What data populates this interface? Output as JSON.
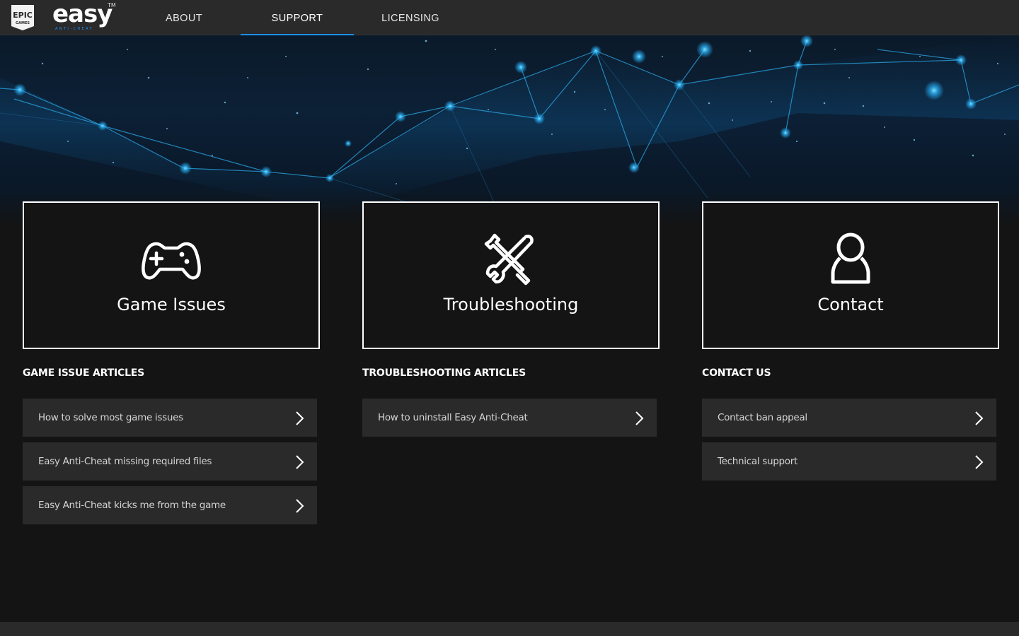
{
  "brand": {
    "epic_top": "EPIC",
    "epic_bottom": "GAMES",
    "product": "easy",
    "tm": "TM",
    "product_sub": "ANTI-CHEAT"
  },
  "nav": {
    "items": [
      {
        "label": "ABOUT",
        "active": false
      },
      {
        "label": "SUPPORT",
        "active": true
      },
      {
        "label": "LICENSING",
        "active": false
      }
    ],
    "accent": "#1b8fe8"
  },
  "cards": [
    {
      "title": "Game Issues",
      "icon": "gamepad-icon"
    },
    {
      "title": "Troubleshooting",
      "icon": "tools-icon"
    },
    {
      "title": "Contact",
      "icon": "user-icon"
    }
  ],
  "sections": [
    {
      "heading": "GAME ISSUE ARTICLES",
      "articles": [
        "How to solve most game issues",
        "Easy Anti-Cheat missing required files",
        "Easy Anti-Cheat kicks me from the game"
      ]
    },
    {
      "heading": "TROUBLESHOOTING ARTICLES",
      "articles": [
        "How to uninstall Easy Anti-Cheat"
      ]
    },
    {
      "heading": "CONTACT US",
      "articles": [
        "Contact ban appeal",
        "Technical support"
      ]
    }
  ],
  "colors": {
    "background": "#141414",
    "nav_bg": "#2a2a2a",
    "row_bg": "#2a2a2a",
    "hero_glow": "#29b6ff"
  }
}
